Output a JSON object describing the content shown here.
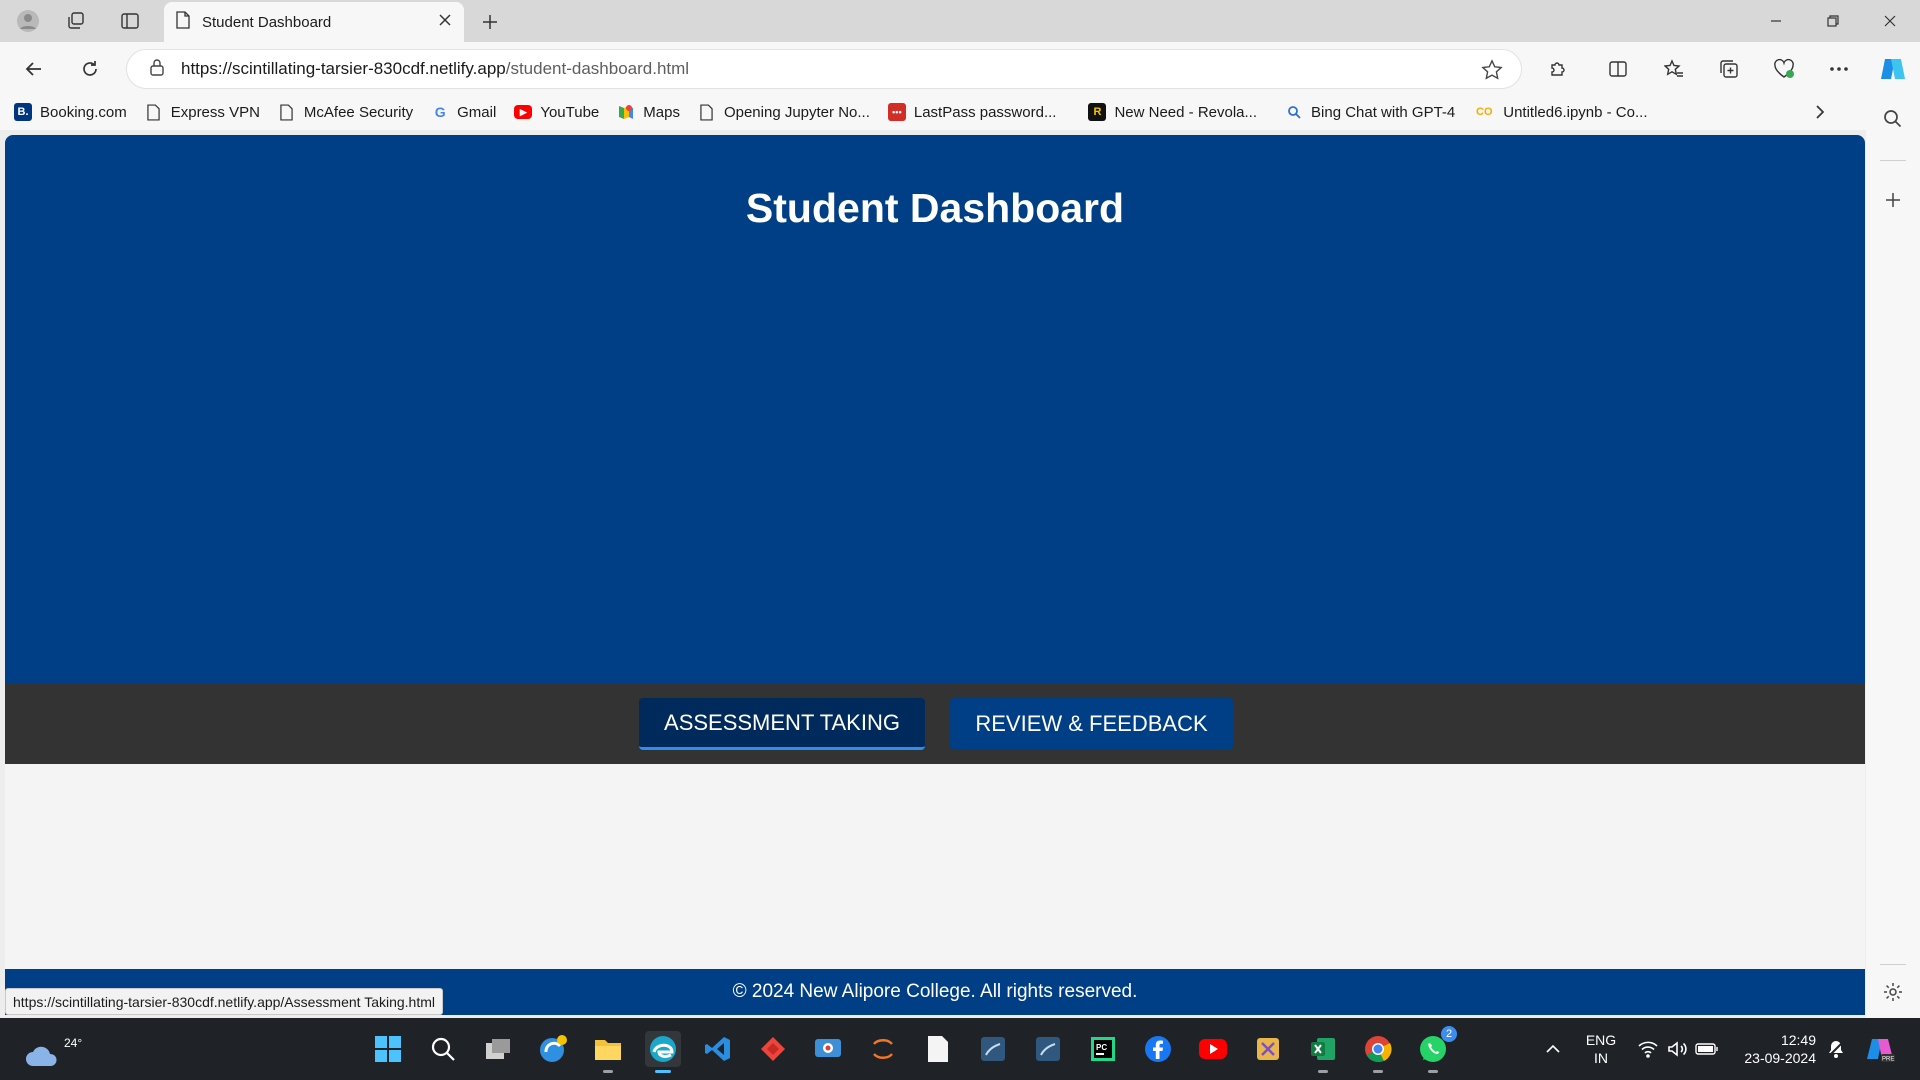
{
  "browser": {
    "tab_title": "Student Dashboard",
    "url_host": "https://scintillating-tarsier-830cdf.netlify.app",
    "url_path": "/student-dashboard.html",
    "status_url": "https://scintillating-tarsier-830cdf.netlify.app/Assessment Taking.html"
  },
  "bookmarks": [
    {
      "label": "Booking.com",
      "icon": "booking-icon",
      "glyph": "B."
    },
    {
      "label": "Express VPN",
      "icon": "page-icon",
      "glyph": ""
    },
    {
      "label": "McAfee Security",
      "icon": "page-icon",
      "glyph": ""
    },
    {
      "label": "Gmail",
      "icon": "google-icon",
      "glyph": "G"
    },
    {
      "label": "YouTube",
      "icon": "youtube-icon",
      "glyph": "▶"
    },
    {
      "label": "Maps",
      "icon": "maps-icon",
      "glyph": ""
    },
    {
      "label": "Opening Jupyter No...",
      "icon": "page-icon",
      "glyph": ""
    },
    {
      "label": "LastPass password...",
      "icon": "lastpass-icon",
      "glyph": "•••"
    },
    {
      "label": "New Need - Revola...",
      "icon": "revola-icon",
      "glyph": "R"
    },
    {
      "label": "Bing Chat with GPT-4",
      "icon": "bing-search-icon",
      "glyph": ""
    },
    {
      "label": "Untitled6.ipynb - Co...",
      "icon": "colab-icon",
      "glyph": "CO"
    }
  ],
  "page": {
    "heading": "Student Dashboard",
    "nav": {
      "assessment": "ASSESSMENT TAKING",
      "review": "REVIEW & FEEDBACK"
    },
    "footer": "© 2024 New Alipore College. All rights reserved."
  },
  "taskbar": {
    "weather_temp": "24°",
    "whatsapp_badge": "2",
    "lang_line1": "ENG",
    "lang_line2": "IN",
    "time": "12:49",
    "date": "23-09-2024"
  },
  "colors": {
    "brand_blue": "#003f85",
    "nav_strip": "#333333",
    "active_button": "#002a5c",
    "active_underline": "#2d8ef0"
  }
}
